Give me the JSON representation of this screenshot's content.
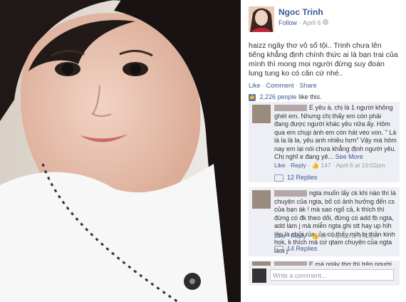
{
  "poster": {
    "name": "Ngoc Trinh",
    "follow": "Follow",
    "dot": "·",
    "date": "April 6",
    "globe_icon": "globe-icon"
  },
  "post": {
    "text": "haizz ngây thơ vô số tội.. Trinh chưa lên tiếng khẳng định chính thức ai là bạn trai của mình thì mong mọi người đừng suy đoán lung tung ko có căn cứ nhé.."
  },
  "actions": {
    "like": "Like",
    "comment": "Comment",
    "share": "Share",
    "sep": "·"
  },
  "likes": {
    "count": "2,226 people",
    "suffix": "like this."
  },
  "comments": [
    {
      "text": "E yêu à, chị là 1 người không ghét em. Nhưng chị thấy em còn phải đang được người khác yêu nữa ấy. Hôm qua em chụp ảnh em còn hát véo von. \" Là là la là la, yêu anh nhiều hơn\" Vậy mà hôm nay em lại nói chưa khẳng định người yêu. Chị nghĩ e đang yê...",
      "see_more": "See More",
      "like": "Like",
      "reply": "Reply",
      "like_count": "147",
      "date": "April 6 at 10:02pm",
      "replies": "12 Replies"
    },
    {
      "text": "ngta muốn lấy ck khi nào thì là chuyện của ngta, bố có ảnh hưởng đến cs của bạn ák ! mà sao ngố cả, k thích thì đừng có đk theo dõi, đừng có add fb ngta, add làm j mà miễn ngta ghi stt hay up hìh lên là chửi rủa, ủa có thấy mìh bị thần kinh hok, k thích mà cứ qtam chuyện của ngta làm j",
      "like": "Like",
      "reply": "Reply",
      "like_count": "97",
      "date": "April 6 at 9:52pm",
      "replies": "14 Replies"
    },
    {
      "text": "E mà ngây thơ thì trên người e ko"
    }
  ],
  "write": {
    "placeholder": "Write a comment..."
  },
  "colors": {
    "link": "#3b5998",
    "comment_bg": "#edeff4",
    "meta": "#999999"
  }
}
